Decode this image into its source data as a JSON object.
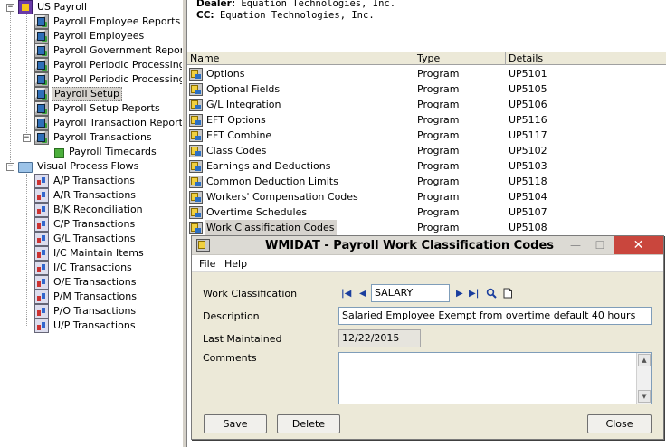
{
  "tree": {
    "root_label": "US Payroll",
    "payroll_items": [
      "Payroll Employee Reports",
      "Payroll Employees",
      "Payroll Government Reports",
      "Payroll Periodic Processing",
      "Payroll Periodic Processing Re",
      "Payroll Setup",
      "Payroll Setup Reports",
      "Payroll Transaction Reports",
      "Payroll Transactions"
    ],
    "timecards_label": "Payroll Timecards",
    "vpf_label": "Visual Process Flows",
    "vpf_items": [
      "A/P Transactions",
      "A/R Transactions",
      "B/K Reconciliation",
      "C/P Transactions",
      "G/L Transactions",
      "I/C Maintain Items",
      "I/C Transactions",
      "O/E Transactions",
      "P/M Transactions",
      "P/O Transactions",
      "U/P Transactions"
    ],
    "selected": "Payroll Setup"
  },
  "header": {
    "dealer_label": "Dealer:",
    "dealer_value": "Equation Technologies, Inc.",
    "cc_label": "CC:",
    "cc_value": "Equation Technologies, Inc."
  },
  "list": {
    "columns": [
      "Name",
      "Type",
      "Details"
    ],
    "rows": [
      {
        "name": "Options",
        "type": "Program",
        "details": "UP5101"
      },
      {
        "name": "Optional Fields",
        "type": "Program",
        "details": "UP5105"
      },
      {
        "name": "G/L Integration",
        "type": "Program",
        "details": "UP5106"
      },
      {
        "name": "EFT Options",
        "type": "Program",
        "details": "UP5116"
      },
      {
        "name": "EFT Combine",
        "type": "Program",
        "details": "UP5117"
      },
      {
        "name": "Class Codes",
        "type": "Program",
        "details": "UP5102"
      },
      {
        "name": "Earnings and Deductions",
        "type": "Program",
        "details": "UP5103"
      },
      {
        "name": "Common Deduction Limits",
        "type": "Program",
        "details": "UP5118"
      },
      {
        "name": "Workers' Compensation Codes",
        "type": "Program",
        "details": "UP5104"
      },
      {
        "name": "Overtime Schedules",
        "type": "Program",
        "details": "UP5107"
      },
      {
        "name": "Work Classification Codes",
        "type": "Program",
        "details": "UP5108"
      }
    ]
  },
  "dialog": {
    "title": "WMIDAT - Payroll Work Classification Codes",
    "menu": [
      "File",
      "Help"
    ],
    "work_classification_label": "Work Classification",
    "work_classification_value": "SALARY",
    "description_label": "Description",
    "description_value": "Salaried Employee Exempt from overtime default 40 hours",
    "last_maintained_label": "Last Maintained",
    "last_maintained_value": "12/22/2015",
    "comments_label": "Comments",
    "comments_value": "",
    "buttons": {
      "save": "Save",
      "delete": "Delete",
      "close": "Close"
    },
    "nav": {
      "first": "|◀",
      "prev": "◀",
      "next": "▶",
      "last": "▶|"
    }
  },
  "colors": {
    "close_button": "#c9463d",
    "window_bg": "#ece9d8",
    "input_border": "#7f9db9"
  }
}
